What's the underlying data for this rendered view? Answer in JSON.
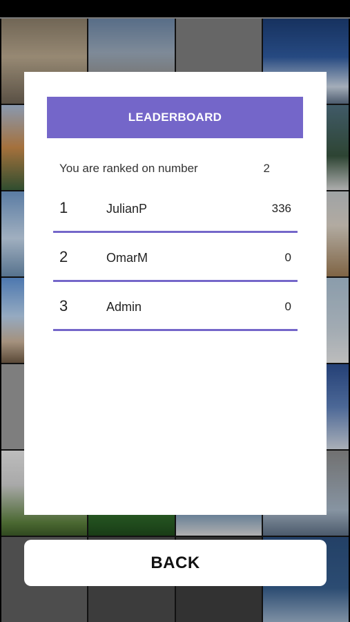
{
  "leaderboard": {
    "title": "LEADERBOARD",
    "rank_label": "You are ranked on number",
    "rank_value": "2",
    "entries": [
      {
        "position": "1",
        "name": "JulianP",
        "score": "336"
      },
      {
        "position": "2",
        "name": "OmarM",
        "score": "0"
      },
      {
        "position": "3",
        "name": "Admin",
        "score": "0"
      }
    ]
  },
  "back_button": {
    "label": "BACK"
  },
  "colors": {
    "accent": "#7466c9",
    "card": "#ffffff"
  }
}
